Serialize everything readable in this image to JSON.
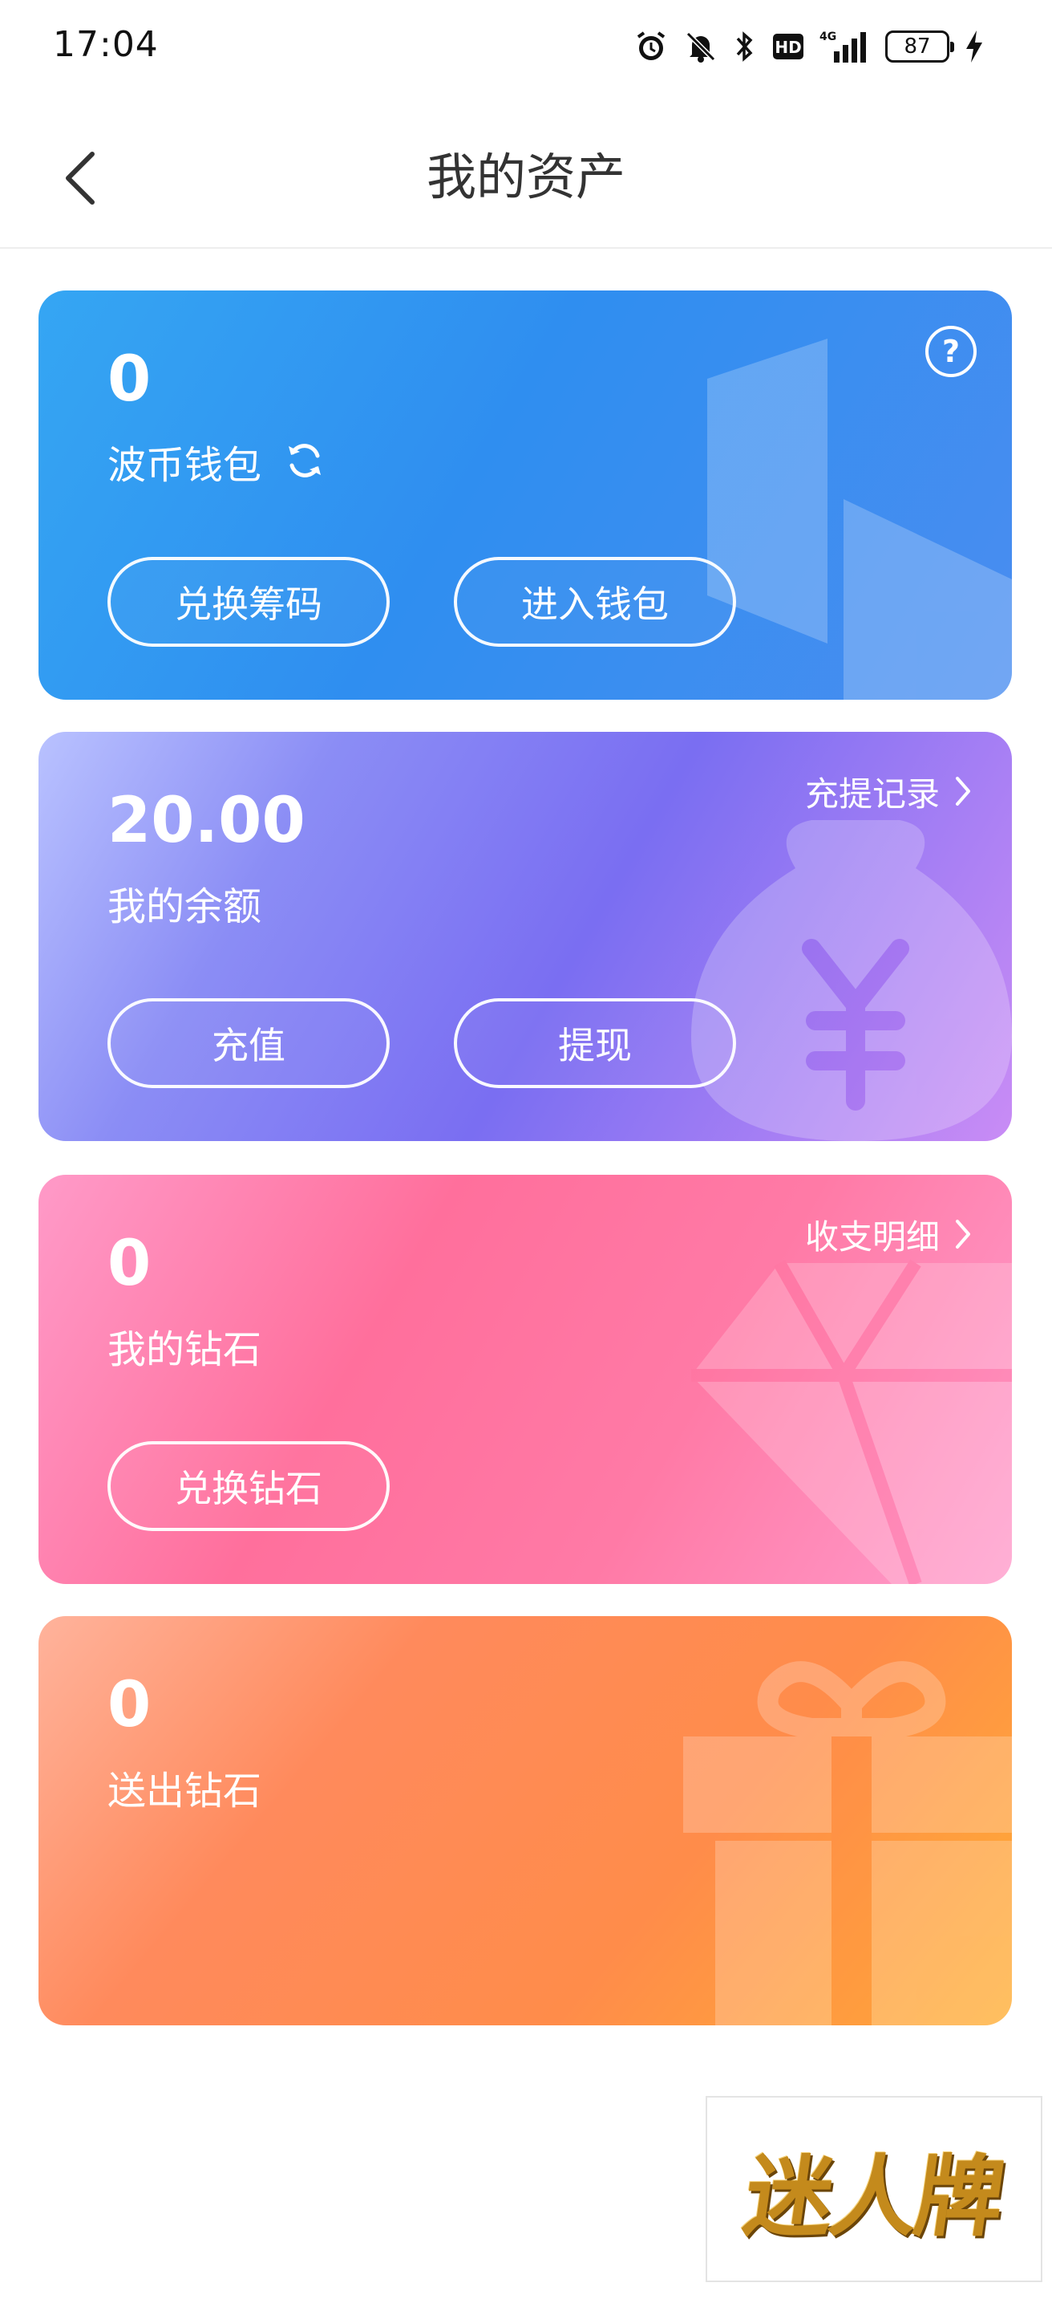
{
  "status_bar": {
    "time": "17:04",
    "network": "4G",
    "battery": "87",
    "icons": [
      "alarm-icon",
      "bell-off-icon",
      "bluetooth-icon",
      "hd-icon",
      "signal-icon",
      "battery-icon",
      "charging-icon"
    ]
  },
  "header": {
    "title": "我的资产",
    "back_icon": "chevron-left-icon"
  },
  "cards": {
    "wallet": {
      "value": "0",
      "label": "波币钱包",
      "button_left": "兑换筹码",
      "button_right": "进入钱包",
      "help": "?",
      "color": "#2f8ef0"
    },
    "balance": {
      "value": "20.00",
      "label": "我的余额",
      "link": "充提记录",
      "button_left": "充值",
      "button_right": "提现",
      "color": "#7a6ef2"
    },
    "diamond": {
      "value": "0",
      "label": "我的钻石",
      "link": "收支明细",
      "button_left": "兑换钻石",
      "color": "#ff6f9c"
    },
    "gift": {
      "value": "0",
      "label": "送出钻石",
      "color": "#ff8c4a"
    }
  },
  "watermark": {
    "text": "迷人牌"
  }
}
